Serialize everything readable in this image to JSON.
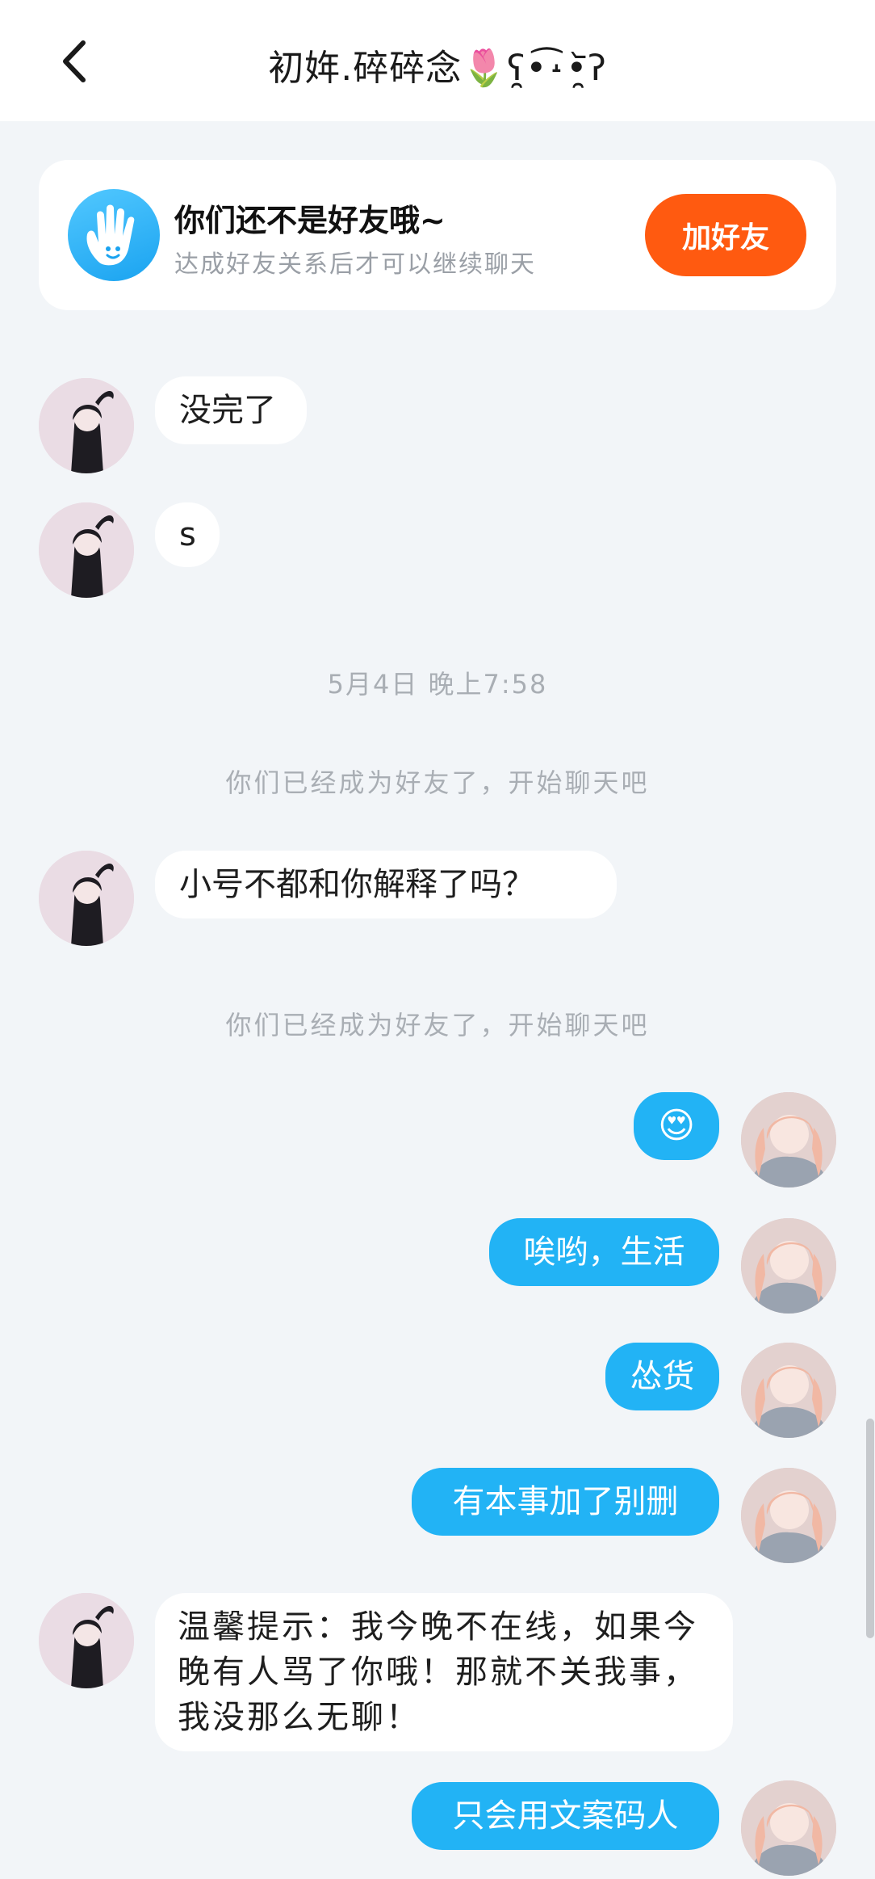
{
  "header": {
    "back_icon": "chevron-left-icon",
    "title": "初姩.碎碎念🌷ʕ̯•͡˔•̯᷅ʔ"
  },
  "banner": {
    "icon": "hand-wave-icon",
    "title": "你们还不是好友哦~",
    "subtitle": "达成好友关系后才可以继续聊天",
    "add_button": "加好友",
    "accent": "#ff5a10"
  },
  "messages": {
    "m1": "没完了",
    "m2": "s",
    "time1": "5月4日 晚上7:58",
    "sys1": "你们已经成为好友了，开始聊天吧",
    "m3": "小号不都和你解释了吗？",
    "sys2": "你们已经成为好友了，开始聊天吧",
    "m4": "😍",
    "m5": "唉哟，生活",
    "m6": "怂货",
    "m7": "有本事加了别删",
    "m8": "温馨提示：我今晚不在线，如果今晚有人骂了你哦！那就不关我事，我没那么无聊！",
    "m9": "只会用文案码人"
  },
  "colors": {
    "background": "#f2f5f8",
    "outgoing_bubble": "#22b3f5",
    "incoming_bubble": "#ffffff",
    "meta_text": "#a9aeb4"
  }
}
